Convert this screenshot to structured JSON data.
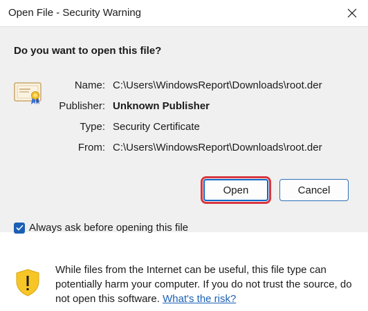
{
  "window": {
    "title": "Open File - Security Warning",
    "close_icon": "close-icon"
  },
  "dialog": {
    "question": "Do you want to open this file?",
    "icon": "certificate-icon",
    "fields": {
      "name": {
        "label": "Name:",
        "value": "C:\\Users\\WindowsReport\\Downloads\\root.der"
      },
      "publisher": {
        "label": "Publisher:",
        "value": "Unknown Publisher"
      },
      "type": {
        "label": "Type:",
        "value": "Security Certificate"
      },
      "from": {
        "label": "From:",
        "value": "C:\\Users\\WindowsReport\\Downloads\\root.der"
      }
    },
    "buttons": {
      "open": "Open",
      "cancel": "Cancel"
    },
    "checkbox": {
      "label": "Always ask before opening this file",
      "checked": true
    }
  },
  "footer": {
    "icon": "shield-warning-icon",
    "text": "While files from the Internet can be useful, this file type can potentially harm your computer. If you do not trust the source, do not open this software.",
    "link": "What's the risk?"
  },
  "colors": {
    "accent": "#1b5fb4",
    "highlight": "#d9363e",
    "panel": "#f0f0f0",
    "shield_yellow": "#f7c626"
  }
}
